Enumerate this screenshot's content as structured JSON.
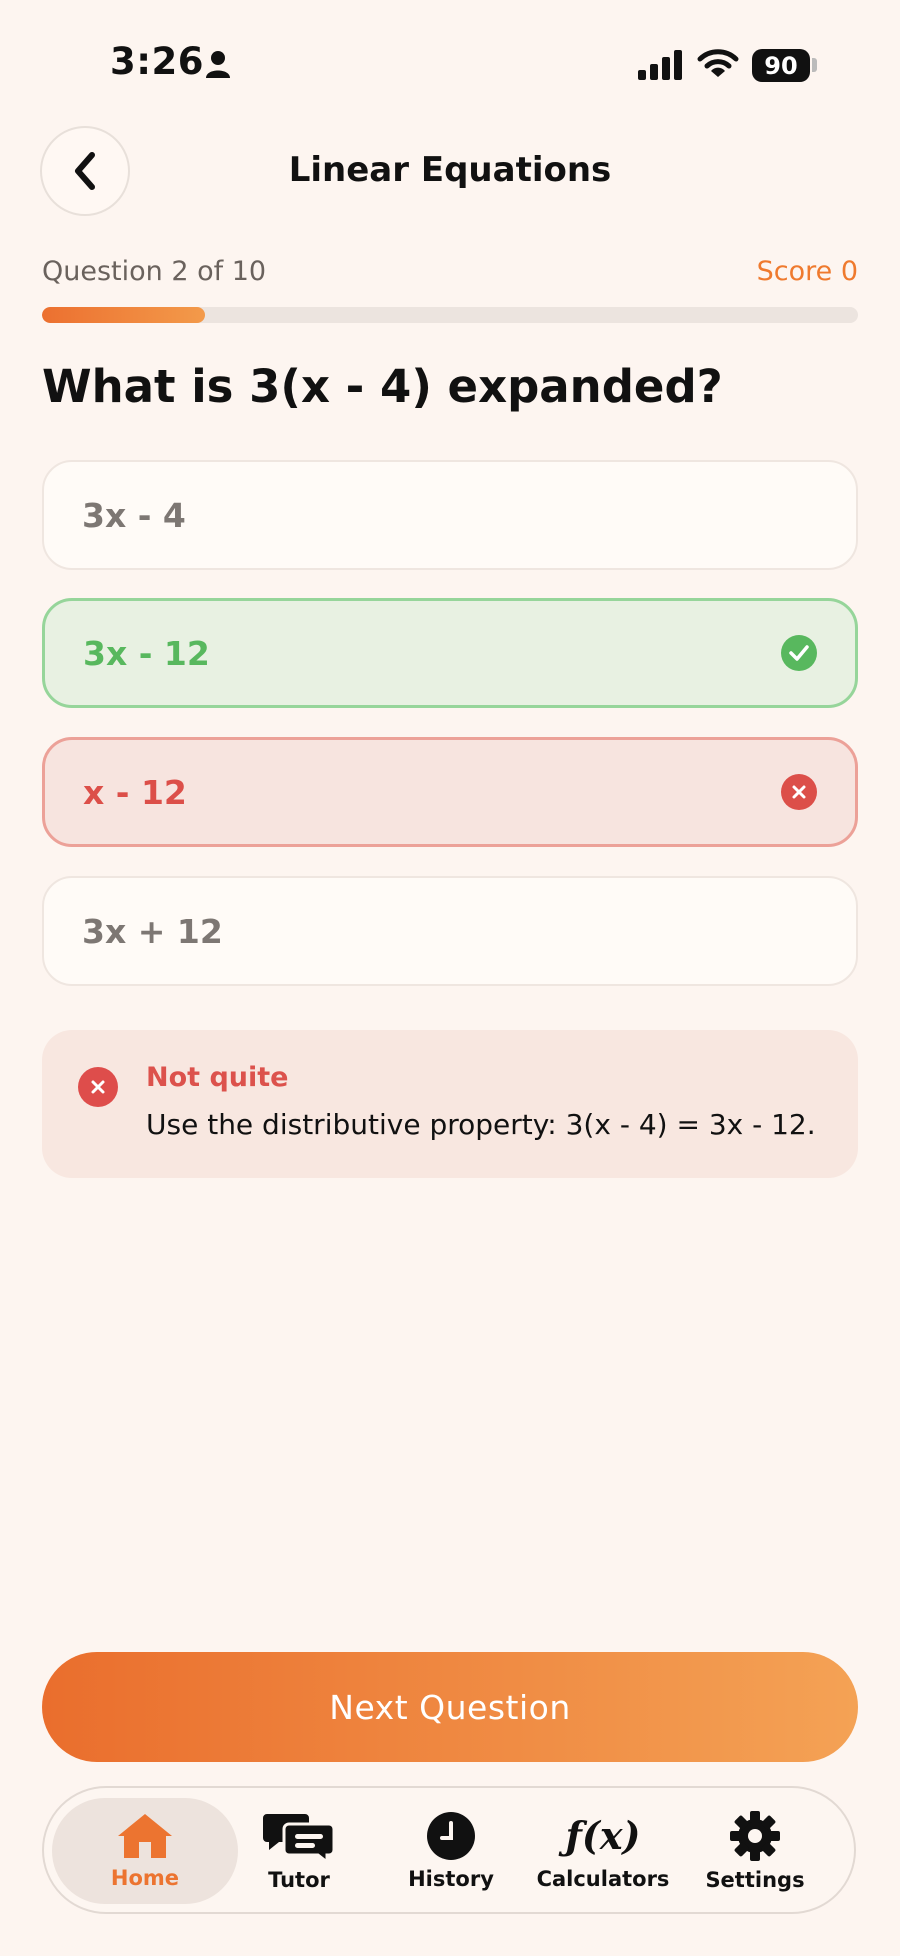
{
  "status_bar": {
    "time": "3:26",
    "battery": "90"
  },
  "header": {
    "title": "Linear Equations"
  },
  "progress": {
    "label": "Question 2 of 10",
    "score": "Score 0",
    "fraction": 0.2
  },
  "question": "What is 3(x - 4) expanded?",
  "options": [
    {
      "text": "3x - 4",
      "state": "neutral"
    },
    {
      "text": "3x - 12",
      "state": "correct"
    },
    {
      "text": "x - 12",
      "state": "wrong"
    },
    {
      "text": "3x + 12",
      "state": "neutral"
    }
  ],
  "feedback": {
    "title": "Not quite",
    "text": "Use the distributive property: 3(x - 4) = 3x - 12."
  },
  "next_button": "Next Question",
  "tabbar": {
    "items": [
      {
        "label": "Home",
        "icon": "home-icon",
        "active": true
      },
      {
        "label": "Tutor",
        "icon": "chat-icon",
        "active": false
      },
      {
        "label": "History",
        "icon": "clock-icon",
        "active": false
      },
      {
        "label": "Calculators",
        "icon": "function-icon",
        "active": false
      },
      {
        "label": "Settings",
        "icon": "gear-icon",
        "active": false
      }
    ]
  },
  "colors": {
    "accent": "#ec7430",
    "correct": "#58b85e",
    "wrong": "#dc4f49",
    "background": "#fdf5f0"
  }
}
